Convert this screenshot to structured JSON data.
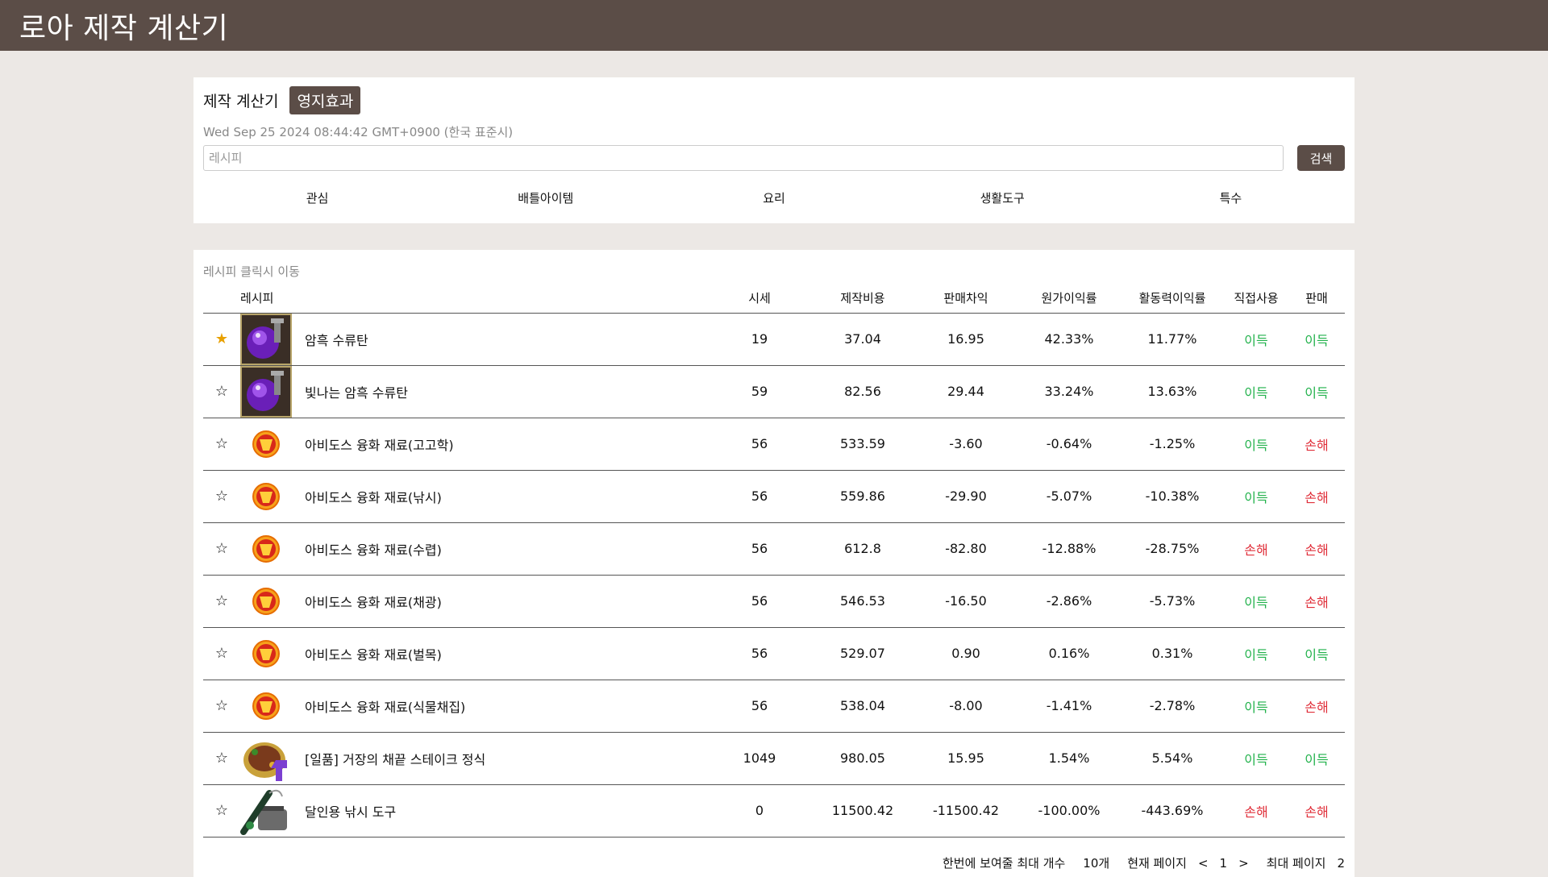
{
  "header": {
    "title": "로아 제작 계산기"
  },
  "calculator": {
    "title": "제작 계산기",
    "territory_button": "영지효과",
    "datetime": "Wed Sep 25 2024 08:44:42 GMT+0900 (한국 표준시)",
    "search_placeholder": "레시피",
    "search_button": "검색",
    "tabs": [
      "관심",
      "배틀아이템",
      "요리",
      "생활도구",
      "특수"
    ]
  },
  "recipes": {
    "hint": "레시피 클릭시 이동",
    "columns": {
      "recipe": "레시피",
      "price": "시세",
      "cost": "제작비용",
      "diff": "판매차익",
      "margin": "원가이익률",
      "energy_margin": "활동력이익률",
      "direct_use": "직접사용",
      "sale": "판매"
    },
    "rows": [
      {
        "fav": true,
        "icon": "dark-grenade-icon",
        "name": "암흑 수류탄",
        "price": "19",
        "cost": "37.04",
        "diff": "16.95",
        "margin": "42.33%",
        "energy": "11.77%",
        "direct": "이득",
        "sale": "이득"
      },
      {
        "fav": false,
        "icon": "dark-grenade-icon",
        "name": "빛나는 암흑 수류탄",
        "price": "59",
        "cost": "82.56",
        "diff": "29.44",
        "margin": "33.24%",
        "energy": "13.63%",
        "direct": "이득",
        "sale": "이득"
      },
      {
        "fav": false,
        "icon": "fusion-material-icon",
        "name": "아비도스 융화 재료(고고학)",
        "price": "56",
        "cost": "533.59",
        "diff": "-3.60",
        "margin": "-0.64%",
        "energy": "-1.25%",
        "direct": "이득",
        "sale": "손해"
      },
      {
        "fav": false,
        "icon": "fusion-material-icon",
        "name": "아비도스 융화 재료(낚시)",
        "price": "56",
        "cost": "559.86",
        "diff": "-29.90",
        "margin": "-5.07%",
        "energy": "-10.38%",
        "direct": "이득",
        "sale": "손해"
      },
      {
        "fav": false,
        "icon": "fusion-material-icon",
        "name": "아비도스 융화 재료(수렵)",
        "price": "56",
        "cost": "612.8",
        "diff": "-82.80",
        "margin": "-12.88%",
        "energy": "-28.75%",
        "direct": "손해",
        "sale": "손해"
      },
      {
        "fav": false,
        "icon": "fusion-material-icon",
        "name": "아비도스 융화 재료(채광)",
        "price": "56",
        "cost": "546.53",
        "diff": "-16.50",
        "margin": "-2.86%",
        "energy": "-5.73%",
        "direct": "이득",
        "sale": "손해"
      },
      {
        "fav": false,
        "icon": "fusion-material-icon",
        "name": "아비도스 융화 재료(벌목)",
        "price": "56",
        "cost": "529.07",
        "diff": "0.90",
        "margin": "0.16%",
        "energy": "0.31%",
        "direct": "이득",
        "sale": "이득"
      },
      {
        "fav": false,
        "icon": "fusion-material-icon",
        "name": "아비도스 융화 재료(식물채집)",
        "price": "56",
        "cost": "538.04",
        "diff": "-8.00",
        "margin": "-1.41%",
        "energy": "-2.78%",
        "direct": "이득",
        "sale": "손해"
      },
      {
        "fav": false,
        "icon": "steak-meal-icon",
        "name": "[일품] 거장의 채끝 스테이크 정식",
        "price": "1049",
        "cost": "980.05",
        "diff": "15.95",
        "margin": "1.54%",
        "energy": "5.54%",
        "direct": "이득",
        "sale": "이득"
      },
      {
        "fav": false,
        "icon": "fishing-tool-icon",
        "name": "달인용 낚시 도구",
        "price": "0",
        "cost": "11500.42",
        "diff": "-11500.42",
        "margin": "-100.00%",
        "energy": "-443.69%",
        "direct": "손해",
        "sale": "손해"
      }
    ]
  },
  "pager": {
    "per_page_label": "한번에 보여줄 최대 개수",
    "per_page_value": "10개",
    "current_label": "현재 페이지",
    "prev": "<",
    "current": "1",
    "next": ">",
    "max_label": "최대 페이지",
    "max_value": "2"
  },
  "colors": {
    "header": "#5b4d47",
    "gain": "#22b24c",
    "loss": "#e02f3a",
    "star": "#e8a000"
  }
}
